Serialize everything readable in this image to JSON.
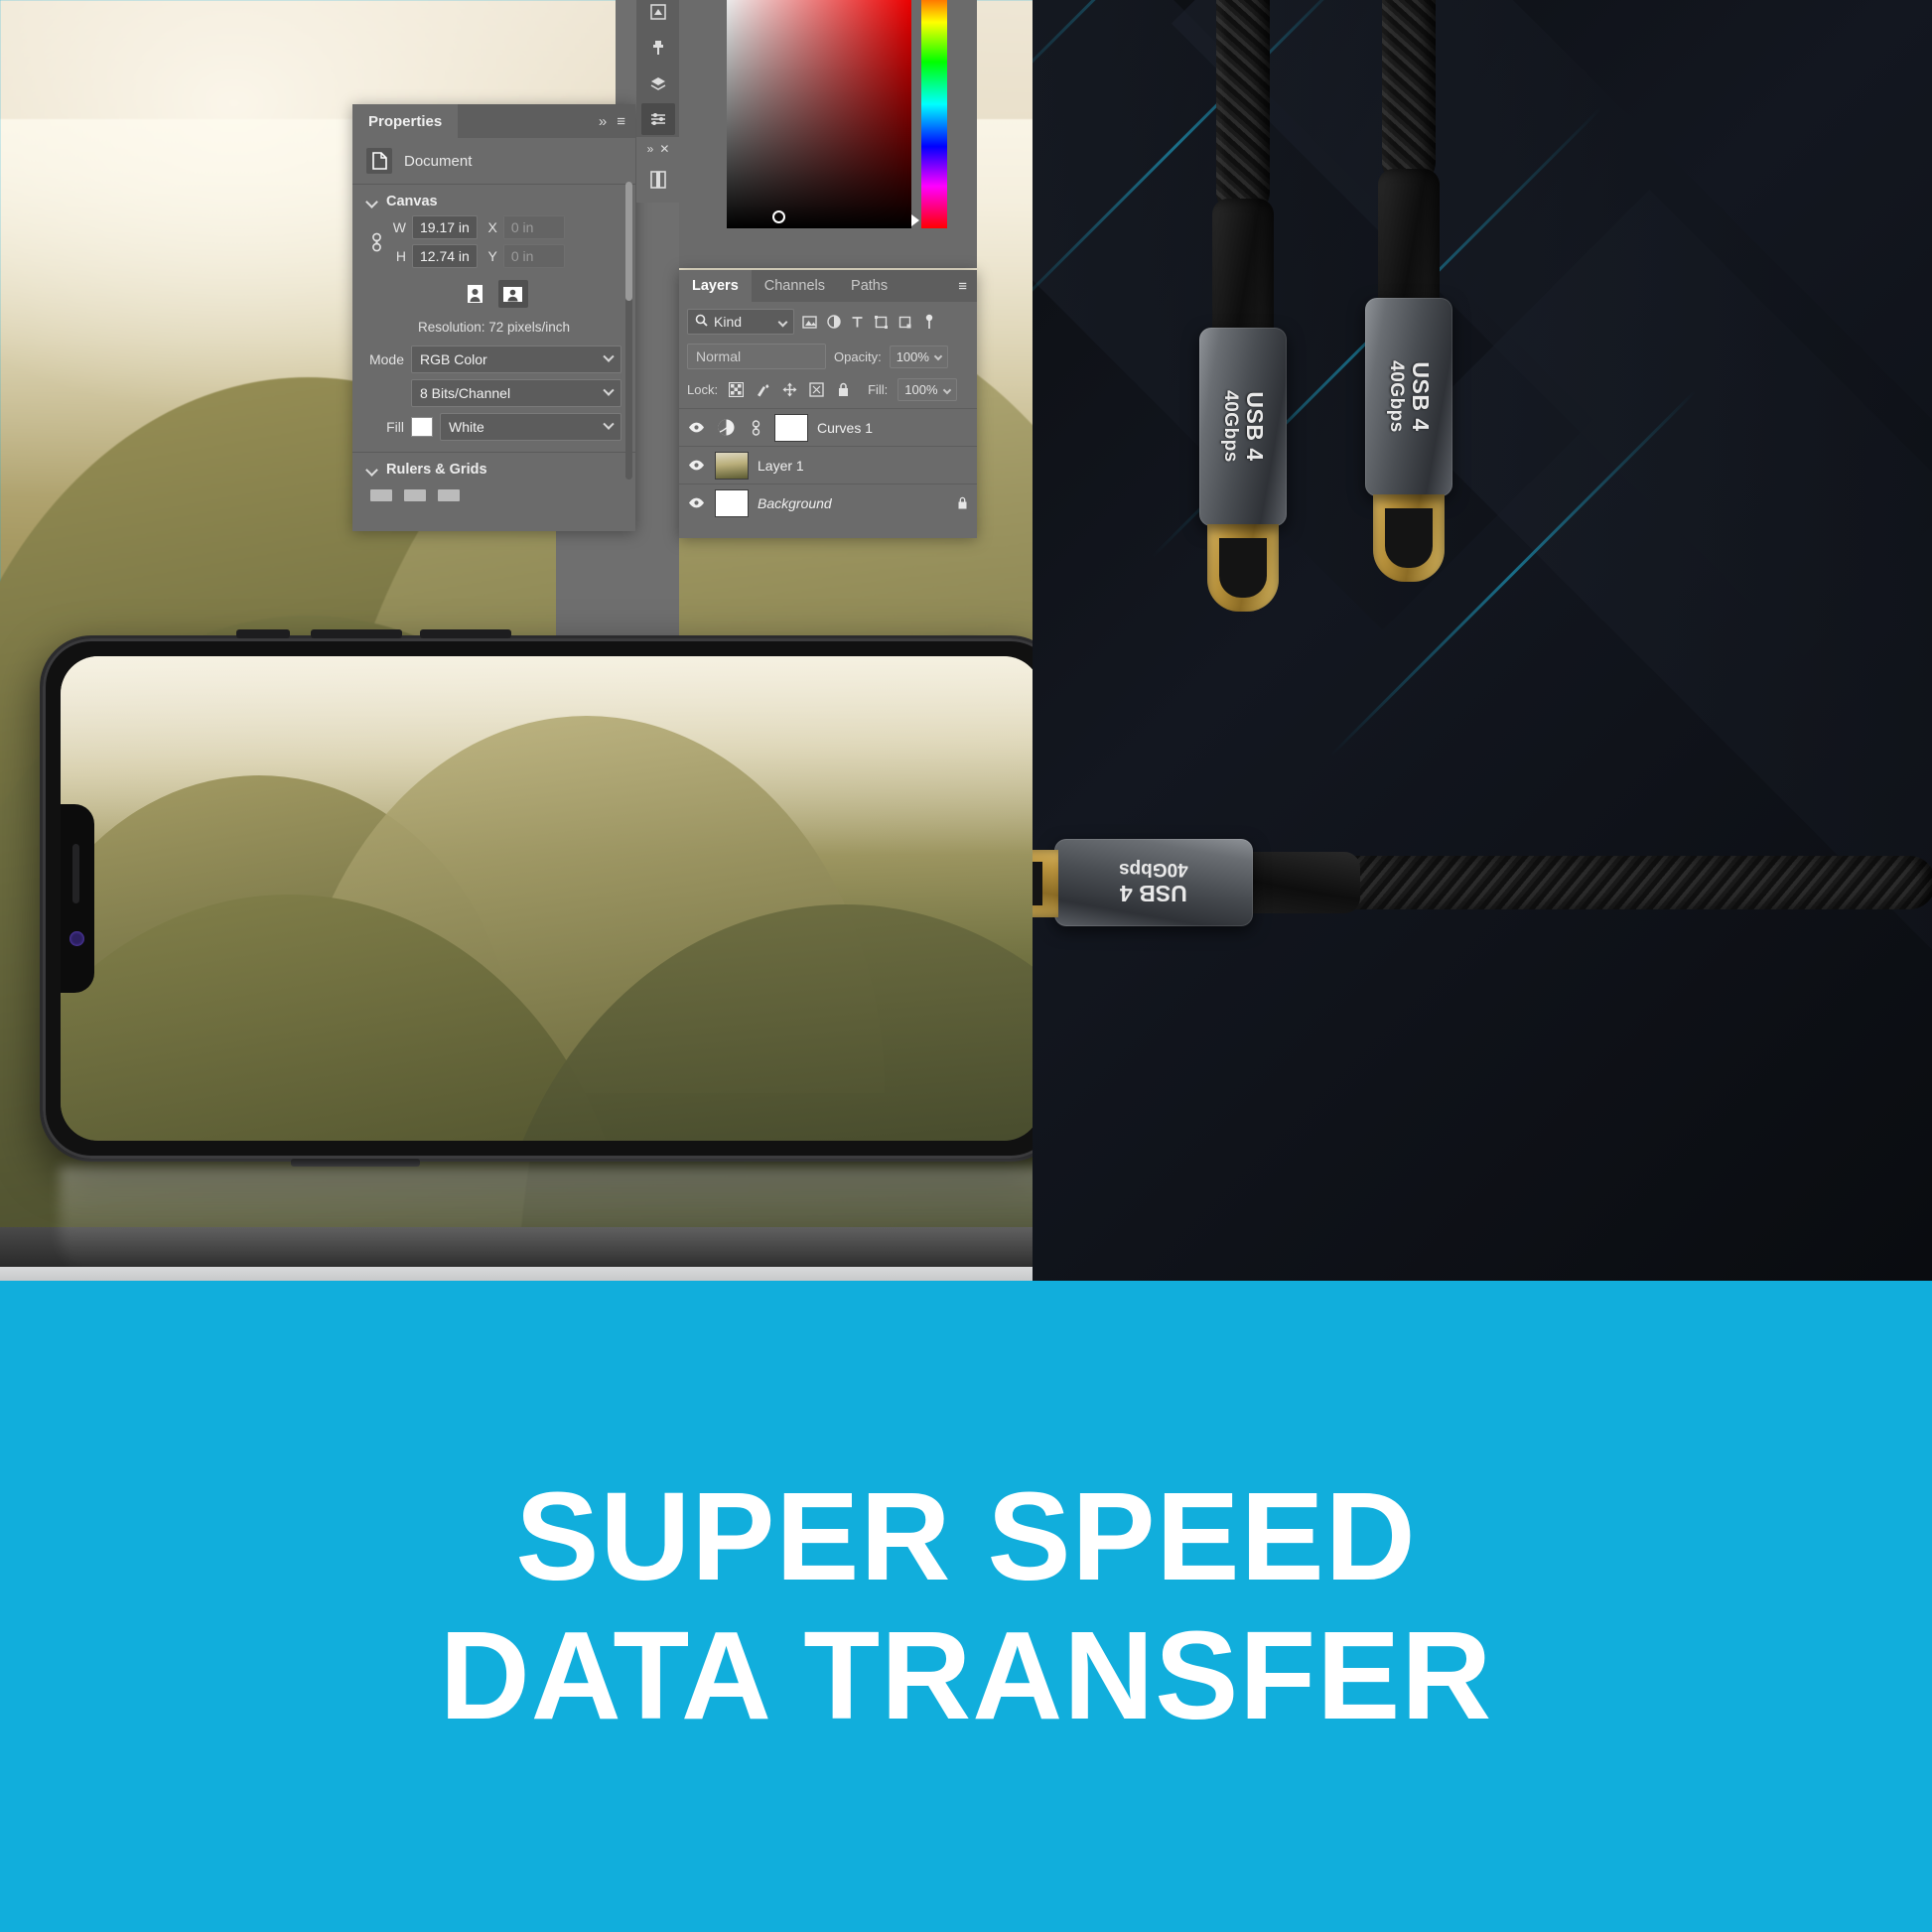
{
  "brand": {
    "accent_cyan": "#11aedc",
    "panel_gray": "#6b6b6b"
  },
  "headline": {
    "line1": "SUPER SPEED",
    "line2": "DATA TRANSFER"
  },
  "photoshop": {
    "properties_panel": {
      "tab_label": "Properties",
      "collapse_icon": "chevron-double-right-icon",
      "menu_icon": "panel-menu-icon",
      "document_icon": "document-icon",
      "document_label": "Document",
      "canvas_section": {
        "title": "Canvas",
        "collapse_icon": "chevron-down-icon",
        "link_icon": "link-dimensions-icon",
        "width_label": "W",
        "width_value": "19.17 in",
        "height_label": "H",
        "height_value": "12.74 in",
        "x_label": "X",
        "x_value": "0 in",
        "y_label": "Y",
        "y_value": "0 in",
        "orientation_portrait_icon": "portrait-orientation-icon",
        "orientation_landscape_icon": "landscape-orientation-icon",
        "orientation_selected": "landscape",
        "resolution_text": "Resolution: 72 pixels/inch",
        "mode_label": "Mode",
        "mode_value": "RGB Color",
        "depth_value": "8 Bits/Channel",
        "fill_label": "Fill",
        "fill_value": "White",
        "fill_swatch_color": "#ffffff"
      },
      "rulers_section": {
        "title": "Rulers & Grids",
        "collapse_icon": "chevron-down-icon",
        "icons": [
          "rulers-icon",
          "grid-icon",
          "guides-icon"
        ]
      },
      "scrollbar_icon": "vertical-scrollbar"
    },
    "icon_strip": {
      "buttons": [
        {
          "name": "adjustments-icon"
        },
        {
          "name": "clone-stamp-icon"
        },
        {
          "name": "layers-comps-icon"
        },
        {
          "name": "properties-sliders-icon",
          "selected": true
        },
        {
          "name": "libraries-icon"
        }
      ],
      "collapse_icons": [
        "chevron-double-right-icon",
        "close-icon"
      ]
    },
    "color_panel": {
      "gradient_icon": "color-field",
      "hue_strip_icon": "hue-slider",
      "picker_cursor_icon": "color-picker-cursor"
    },
    "layers_panel": {
      "tabs": [
        {
          "label": "Layers",
          "active": true
        },
        {
          "label": "Channels",
          "active": false
        },
        {
          "label": "Paths",
          "active": false
        }
      ],
      "menu_icon": "panel-menu-icon",
      "filter": {
        "search_icon": "search-icon",
        "kind_label": "Kind",
        "carat_icon": "chevron-down-icon",
        "type_icons": [
          "filter-pixel-icon",
          "filter-adjustment-icon",
          "filter-type-icon",
          "filter-shape-icon",
          "filter-smart-object-icon"
        ],
        "toggle_icon": "filter-toggle-icon"
      },
      "blend_mode": "Normal",
      "opacity_label": "Opacity:",
      "opacity_value": "100%",
      "lock_label": "Lock:",
      "lock_icons": [
        "lock-transparent-pixels-icon",
        "lock-image-pixels-icon",
        "lock-position-icon",
        "lock-artboard-icon",
        "lock-all-icon"
      ],
      "fill_label": "Fill:",
      "fill_value": "100%",
      "layers": [
        {
          "visible_icon": "eye-icon",
          "kind_icon": "curves-adjustment-icon",
          "link_icon": "layer-mask-link-icon",
          "thumb": "white-mask",
          "name": "Curves 1",
          "italic": false,
          "locked_icon": ""
        },
        {
          "visible_icon": "eye-icon",
          "kind_icon": "",
          "link_icon": "",
          "thumb": "photo",
          "name": "Layer 1",
          "italic": false,
          "locked_icon": ""
        },
        {
          "visible_icon": "eye-icon",
          "kind_icon": "",
          "link_icon": "",
          "thumb": "white",
          "name": "Background",
          "italic": true,
          "locked_icon": "lock-icon"
        }
      ]
    }
  },
  "product": {
    "connectors": [
      {
        "id": "connector-left",
        "line1": "USB 4",
        "line2": "40Gbps"
      },
      {
        "id": "connector-right",
        "line1": "USB 4",
        "line2": "40Gbps"
      },
      {
        "id": "connector-plugged",
        "line1": "USB 4",
        "line2": "40Gbps"
      }
    ]
  },
  "phone": {
    "wallpaper_icon": "mountain-landscape-photo",
    "notch_camera_icon": "front-camera-icon",
    "notch_speaker_icon": "earpiece-speaker-icon"
  }
}
